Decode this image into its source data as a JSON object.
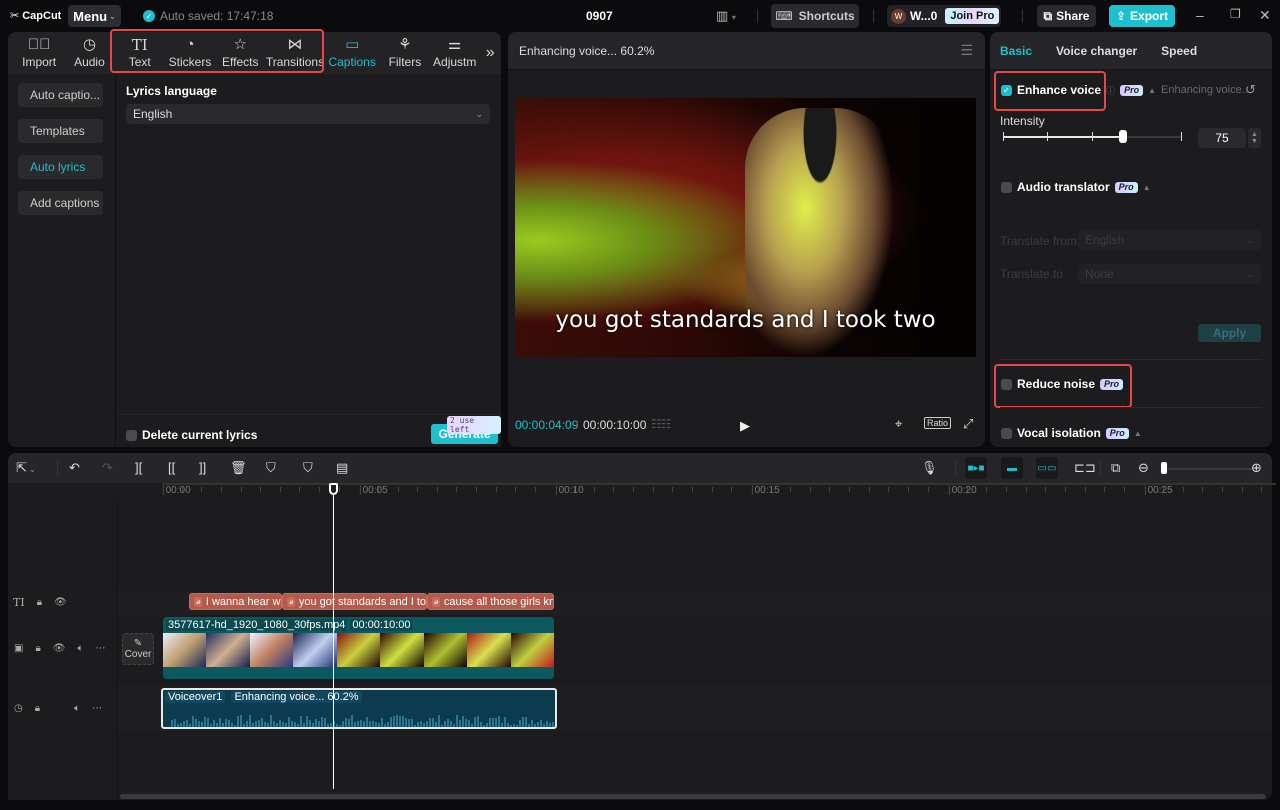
{
  "app": {
    "name": "CapCut",
    "menu_label": "Menu",
    "autosave": "Auto saved: 17:47:18",
    "project_title": "0907",
    "shortcuts_label": "Shortcuts",
    "user_initial": "W",
    "user_name": "W...0",
    "join_pro_label": "Join Pro",
    "share_label": "Share",
    "export_label": "Export",
    "accent_color": "#1fbfcf"
  },
  "toolbar": {
    "items": [
      {
        "label": "Import",
        "icon": "import-icon"
      },
      {
        "label": "Audio",
        "icon": "audio-icon"
      },
      {
        "label": "Text",
        "icon": "text-icon"
      },
      {
        "label": "Stickers",
        "icon": "stickers-icon"
      },
      {
        "label": "Effects",
        "icon": "effects-icon"
      },
      {
        "label": "Transitions",
        "icon": "transitions-icon"
      },
      {
        "label": "Captions",
        "icon": "captions-icon",
        "active": true
      },
      {
        "label": "Filters",
        "icon": "filters-icon"
      },
      {
        "label": "Adjustm",
        "icon": "adjustment-icon"
      }
    ],
    "more_icon": "»"
  },
  "captions_panel": {
    "subnav": [
      "Auto captio...",
      "Templates",
      "Auto lyrics",
      "Add captions"
    ],
    "active_subnav": "Auto lyrics",
    "lyrics_language_label": "Lyrics language",
    "lyrics_language_value": "English",
    "delete_lyrics_label": "Delete current lyrics",
    "generate_label": "Generate",
    "uses_left": "2 use left"
  },
  "player": {
    "title": "Enhancing voice... 60.2%",
    "caption_overlay": "you got standards and I took two",
    "current_time": "00:00:04:09",
    "total_time": "00:00:10:00",
    "ratio_label": "Ratio"
  },
  "audio_panel": {
    "tabs": [
      "Basic",
      "Voice changer",
      "Speed"
    ],
    "active_tab": "Basic",
    "enhance_voice": {
      "label": "Enhance voice",
      "checked": true,
      "status": "Enhancing voice...",
      "pro": "Pro"
    },
    "intensity": {
      "label": "Intensity",
      "value": "75",
      "fraction": 0.75
    },
    "audio_translator": {
      "label": "Audio translator",
      "checked": false,
      "pro": "Pro"
    },
    "translate_from": {
      "label": "Translate from",
      "value": "English"
    },
    "translate_to": {
      "label": "Translate to",
      "value": "None"
    },
    "apply_label": "Apply",
    "reduce_noise": {
      "label": "Reduce noise",
      "checked": false,
      "pro": "Pro"
    },
    "vocal_isolation": {
      "label": "Vocal isolation",
      "checked": false,
      "pro": "Pro"
    }
  },
  "timeline": {
    "ruler": [
      "00:00",
      "00:05",
      "00:10",
      "00:15",
      "00:20",
      "00:25"
    ],
    "playhead_time": "00:00:04:09",
    "caption_clips": [
      "I wanna hear wh",
      "you got standards and I to",
      "cause all those girls kn"
    ],
    "caption_clip_icon": "ꭷ",
    "video_clip": {
      "name": "3577617-hd_1920_1080_30fps.mp4",
      "duration": "00:00:10:00"
    },
    "cover_label": "Cover",
    "audio_clip": {
      "name": "Voiceover1",
      "status": "Enhancing voice... 60.2%"
    },
    "zoom_level": 0.05
  }
}
